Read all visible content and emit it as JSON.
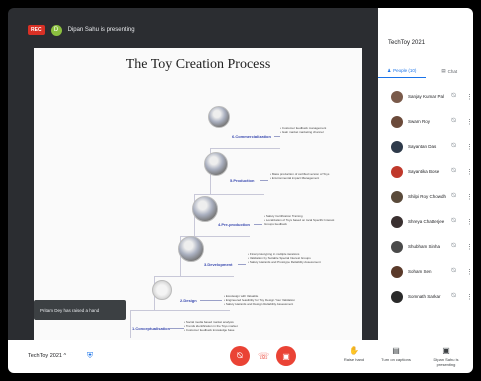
{
  "top_bar": {
    "rec_badge": "REC",
    "presenter_initial": "D",
    "presenting_text": "Dipan Sahu is presenting"
  },
  "slide": {
    "title": "The Toy Creation Process",
    "stages": [
      {
        "label": "6.Commercialization",
        "notes": "• Customer feedback management\n• Gain market marketing channel"
      },
      {
        "label": "5.Production",
        "notes": "• Mass production of certified version of Toys\n• Environmental impact Management"
      },
      {
        "label": "4.Pre-production",
        "notes": "• Safety Certification Training\n• Localization of Toys based on local Specific Interest Groups feedback"
      },
      {
        "label": "3.Development",
        "notes": "• Final prototyping in multiple iterations\n• Validation by Suitable Special Interest Groups\n• Safety Hazards and Prototype Reliability Assessment"
      },
      {
        "label": "2.Design",
        "notes": "• Ecodesign with Valuable\n• Engineered feasibility for Toy Design Your Validation\n• Safety Hazards and Design Reliability Assessment"
      },
      {
        "label": "1.Conceptualisation",
        "notes": "• Social media based market analysis\n• Trends identification in the Toys market\n• Customer feedback knowledge base"
      }
    ]
  },
  "toast": {
    "text": "Pritam Dey has raised a hand"
  },
  "panel": {
    "title": "TechToy 2021",
    "tabs": [
      {
        "label": "People (10)",
        "icon": "people-icon"
      },
      {
        "label": "Chat",
        "icon": "chat-icon"
      }
    ],
    "people": [
      {
        "name": "Sanjay Kumar Pal",
        "color": "#7a5a4a"
      },
      {
        "name": "Swarn Roy",
        "color": "#6b4a3a"
      },
      {
        "name": "Sayantan Das",
        "color": "#2e3a4a"
      },
      {
        "name": "Sayantika Bose",
        "color": "#c0392b"
      },
      {
        "name": "Shilpi Roy Chowdhury",
        "color": "#5a4a3a"
      },
      {
        "name": "Shreya Chatterjee",
        "color": "#3a3030"
      },
      {
        "name": "Shubham Sinha",
        "color": "#4a4a4a"
      },
      {
        "name": "Soham Sen",
        "color": "#5a3a2a"
      },
      {
        "name": "Somnath Sarkar",
        "color": "#2a2a2a"
      }
    ]
  },
  "bottom_bar": {
    "meeting_name": "TechToy 2021",
    "expand_glyph": "^",
    "raise_hand_label": "Raise hand",
    "captions_label": "Turn on captions",
    "presenting_label": "Dipan Sahu is presenting"
  }
}
